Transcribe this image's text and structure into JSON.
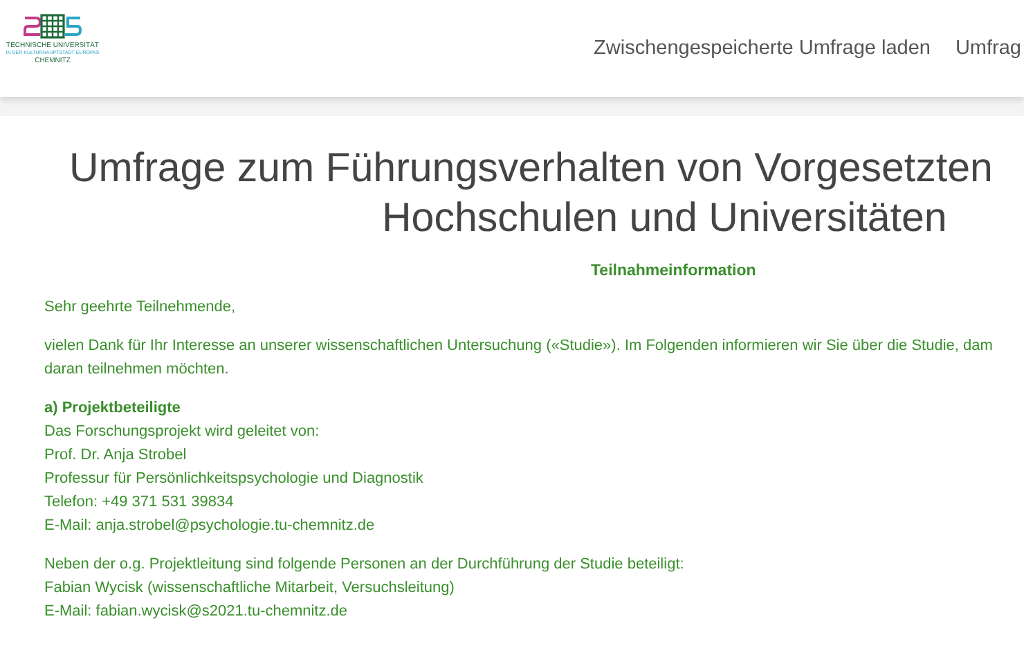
{
  "header": {
    "logo": {
      "line_1": "TECHNISCHE UNIVERSITÄT",
      "line_2": "IN DER KULTURHAUPTSTADT EUROPAS",
      "line_3": "CHEMNITZ"
    },
    "nav": [
      "Zwischengespeicherte Umfrage laden",
      "Umfrag"
    ]
  },
  "title_lines": [
    "Umfrage zum Führungsverhalten von Vorgesetzten",
    "Hochschulen und Universitäten"
  ],
  "section_heading": "Teilnahmeinformation",
  "blocks": [
    {
      "lines": [
        {
          "text": "Sehr geehrte Teilnehmende,",
          "bold": false
        }
      ]
    },
    {
      "lines": [
        {
          "text": "vielen Dank für Ihr Interesse an unserer wissenschaftlichen Untersuchung («Studie»). Im Folgenden informieren wir Sie über die Studie, dam",
          "bold": false
        },
        {
          "text": "daran teilnehmen möchten.",
          "bold": false
        }
      ]
    },
    {
      "lines": [
        {
          "text": "a) Projektbeteiligte",
          "bold": true
        },
        {
          "text": "Das Forschungsprojekt wird geleitet von:",
          "bold": false
        },
        {
          "text": "Prof. Dr. Anja Strobel",
          "bold": false
        },
        {
          "text": "Professur für Persönlichkeitspsychologie und Diagnostik",
          "bold": false
        },
        {
          "text": "Telefon: +49 371 531 39834",
          "bold": false
        },
        {
          "text": "E-Mail: anja.strobel@psychologie.tu-chemnitz.de",
          "bold": false
        }
      ]
    },
    {
      "lines": [
        {
          "text": "Neben der o.g. Projektleitung sind folgende Personen an der Durchführung der Studie beteiligt:",
          "bold": false
        },
        {
          "text": "Fabian Wycisk (wissenschaftliche Mitarbeit, Versuchsleitung)",
          "bold": false
        },
        {
          "text": "E-Mail: fabian.wycisk@s2021.tu-chemnitz.de",
          "bold": false
        }
      ]
    }
  ]
}
